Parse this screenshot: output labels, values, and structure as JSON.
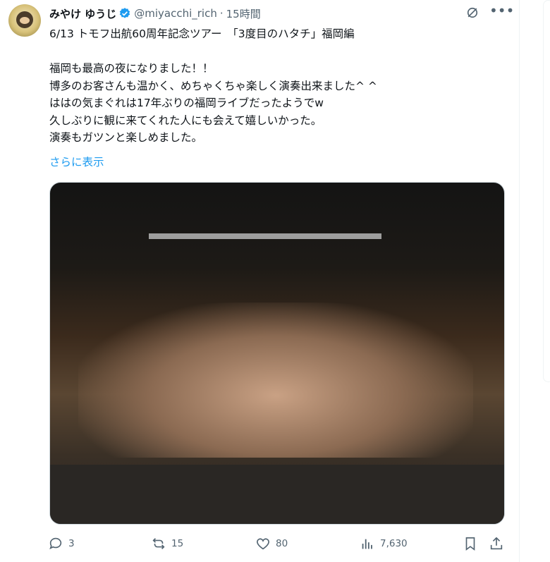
{
  "author": {
    "name": "みやけ ゆうじ",
    "handle": "@miyacchi_rich",
    "separator": "·",
    "time": "15時間"
  },
  "tweet": {
    "text": "6/13 トモフ出航60周年記念ツアー　「3度目のハタチ」福岡編\n\n福岡も最高の夜になりました！！\n博多のお客さんも温かく、めちゃくちゃ楽しく演奏出来ました^ ^\nははの気まぐれは17年ぶりの福岡ライブだったようでw\n久しぶりに観に来てくれた人にも会えて嬉しいかった。\n演奏もガツンと楽しめました。",
    "show_more": "さらに表示"
  },
  "actions": {
    "replies": "3",
    "reposts": "15",
    "likes": "80",
    "views": "7,630"
  },
  "icons": {
    "verified": "verified-badge-icon",
    "grok": "grok-icon",
    "more": "more-icon",
    "reply": "reply-icon",
    "repost": "repost-icon",
    "like": "heart-icon",
    "views": "views-icon",
    "bookmark": "bookmark-icon",
    "share": "share-icon"
  },
  "colors": {
    "accent": "#1d9bf0",
    "muted": "#536471",
    "text": "#0f1419"
  }
}
